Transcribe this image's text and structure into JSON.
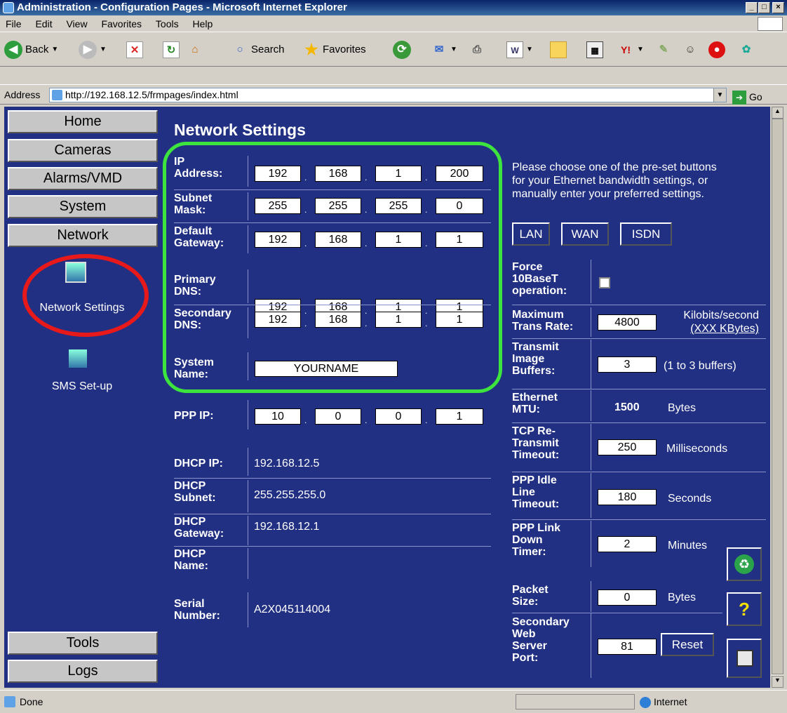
{
  "window": {
    "title": "Administration - Configuration Pages - Microsoft Internet Explorer"
  },
  "menu": [
    "File",
    "Edit",
    "View",
    "Favorites",
    "Tools",
    "Help"
  ],
  "toolbar": {
    "back": "Back",
    "search": "Search",
    "favorites": "Favorites"
  },
  "address": {
    "label": "Address",
    "url": "http://192.168.12.5/frmpages/index.html",
    "go": "Go"
  },
  "nav": {
    "home": "Home",
    "cameras": "Cameras",
    "alarms": "Alarms/VMD",
    "system": "System",
    "network": "Network",
    "network_settings": "Network Settings",
    "sms": "SMS Set-up",
    "tools": "Tools",
    "logs": "Logs"
  },
  "page": {
    "title": "Network Settings"
  },
  "fields": {
    "ip_l1": "IP",
    "ip_l2": "Address:",
    "ip": [
      "192",
      "168",
      "1",
      "200"
    ],
    "subnet_l1": "Subnet",
    "subnet_l2": "Mask:",
    "subnet": [
      "255",
      "255",
      "255",
      "0"
    ],
    "gw_l1": "Default",
    "gw_l2": "Gateway:",
    "gw": [
      "192",
      "168",
      "1",
      "1"
    ],
    "pdns_l1": "Primary",
    "pdns_l2": "DNS:",
    "pdns": [
      "192",
      "168",
      "1",
      "1"
    ],
    "sdns_l1": "Secondary",
    "sdns_l2": "DNS:",
    "sdns": [
      "192",
      "168",
      "1",
      "1"
    ],
    "sysname_l1": "System",
    "sysname_l2": "Name:",
    "sysname": "YOURNAME",
    "ppp_l": "PPP IP:",
    "ppp": [
      "10",
      "0",
      "0",
      "1"
    ],
    "dhcpip_l": "DHCP IP:",
    "dhcpip": "192.168.12.5",
    "dhcpsub_l1": "DHCP",
    "dhcpsub_l2": "Subnet:",
    "dhcpsub": "255.255.255.0",
    "dhcpgw_l1": "DHCP",
    "dhcpgw_l2": "Gateway:",
    "dhcpgw": "192.168.12.1",
    "dhcpname_l1": "DHCP",
    "dhcpname_l2": "Name:",
    "serial_l1": "Serial",
    "serial_l2": "Number:",
    "serial": "A2X045114004"
  },
  "right": {
    "info1": "Please choose one of the pre-set buttons",
    "info2": "for your Ethernet bandwidth settings, or",
    "info3": "manually enter your preferred settings.",
    "lan": "LAN",
    "wan": "WAN",
    "isdn": "ISDN",
    "force_l1": "Force",
    "force_l2": "10BaseT",
    "force_l3": "operation:",
    "maxrate_l1": "Maximum",
    "maxrate_l2": "Trans Rate:",
    "maxrate": "4800",
    "maxrate_u1": "Kilobits/second",
    "maxrate_u2": "(XXX KBytes)",
    "buf_l1": "Transmit",
    "buf_l2": "Image",
    "buf_l3": "Buffers:",
    "buf": "3",
    "buf_u": "(1 to 3 buffers)",
    "mtu_l1": "Ethernet",
    "mtu_l2": "MTU:",
    "mtu": "1500",
    "mtu_u": "Bytes",
    "tcp_l1": "TCP Re-",
    "tcp_l2": "Transmit",
    "tcp_l3": "Timeout:",
    "tcp": "250",
    "tcp_u": "Milliseconds",
    "pppidle_l1": "PPP Idle",
    "pppidle_l2": "Line",
    "pppidle_l3": "Timeout:",
    "pppidle": "180",
    "pppidle_u": "Seconds",
    "ppplink_l1": "PPP Link",
    "ppplink_l2": "Down",
    "ppplink_l3": "Timer:",
    "ppplink": "2",
    "ppplink_u": "Minutes",
    "pkt_l1": "Packet",
    "pkt_l2": "Size:",
    "pkt": "0",
    "pkt_u": "Bytes",
    "web_l1": "Secondary",
    "web_l2": "Web",
    "web_l3": "Server",
    "web_l4": "Port:",
    "web": "81",
    "reset": "Reset",
    "help": "?"
  },
  "status": {
    "text": "Done",
    "zone": "Internet"
  }
}
